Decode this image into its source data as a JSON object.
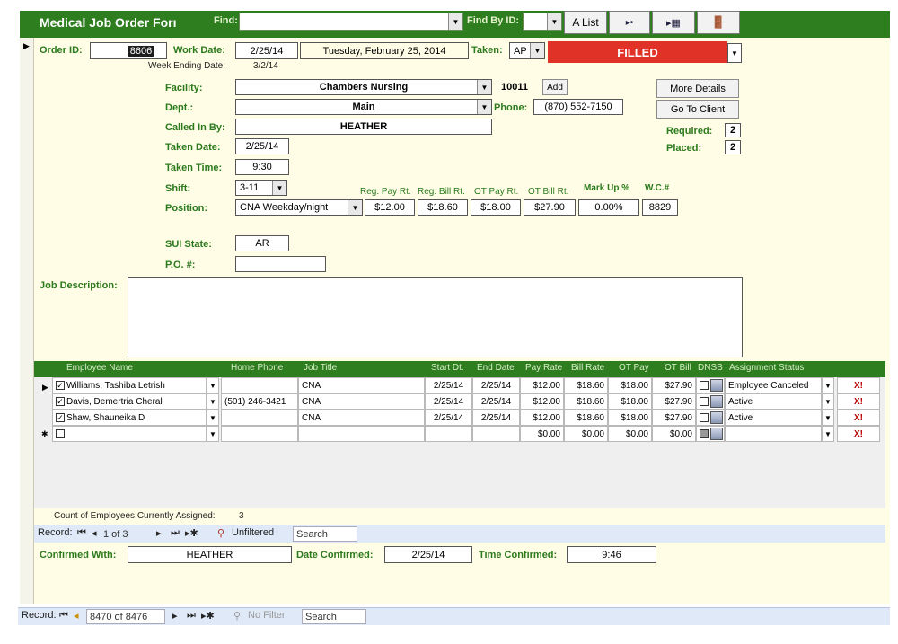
{
  "titlebar": {
    "title": "Medical Job Order Forı",
    "find_label": "Find:",
    "find_value": "",
    "find_by_id_label": "Find By ID:",
    "find_by_id_value": "",
    "a_list_button": "A List",
    "next_icon": "next-record-icon",
    "new_record_icon": "new-record-icon",
    "exit_icon": "exit-door-icon"
  },
  "order": {
    "order_id_label": "Order ID:",
    "order_id": "8606",
    "work_date_label": "Work Date:",
    "work_date": "2/25/14",
    "work_date_long": "Tuesday, February 25, 2014",
    "taken_label": "Taken:",
    "taken_value": "AP",
    "status": "FILLED",
    "week_ending_label": "Week Ending Date:",
    "week_ending": "3/2/14",
    "facility_label": "Facility:",
    "facility": "Chambers Nursing",
    "facility_id": "10011",
    "add_button": "Add",
    "dept_label": "Dept.:",
    "dept": "Main",
    "phone_label": "Phone:",
    "phone": "(870) 552-7150",
    "called_in_by_label": "Called In By:",
    "called_in_by": "HEATHER",
    "more_details_button": "More Details",
    "go_to_client_button": "Go To Client",
    "required_label": "Required:",
    "required": "2",
    "placed_label": "Placed:",
    "placed": "2",
    "taken_date_label": "Taken Date:",
    "taken_date": "2/25/14",
    "taken_time_label": "Taken Time:",
    "taken_time": "9:30",
    "shift_label": "Shift:",
    "shift": "3-11",
    "position_label": "Position:",
    "position": "CNA Weekday/night",
    "reg_pay_label": "Reg. Pay Rt.",
    "reg_pay": "$12.00",
    "reg_bill_label": "Reg. Bill Rt.",
    "reg_bill": "$18.60",
    "ot_pay_label": "OT Pay Rt.",
    "ot_pay": "$18.00",
    "ot_bill_label": "OT Bill Rt.",
    "ot_bill": "$27.90",
    "markup_label": "Mark Up %",
    "markup": "0.00%",
    "wc_label": "W.C.#",
    "wc": "8829",
    "sui_label": "SUI State:",
    "sui": "AR",
    "po_label": "P.O. #:",
    "po": "",
    "job_desc_label": "Job Description:",
    "job_desc": ""
  },
  "subform": {
    "headers": [
      "Employee Name",
      "Home Phone",
      "Job Title",
      "Start Dt.",
      "End Date",
      "Pay Rate",
      "Bill Rate",
      "OT Pay",
      "OT Bill",
      "DNSB",
      "Assignment Status"
    ],
    "rows": [
      {
        "name": "Williams, Tashiba Letrish",
        "phone": "",
        "title": "CNA",
        "start": "2/25/14",
        "end": "2/25/14",
        "pay": "$12.00",
        "bill": "$18.60",
        "otpay": "$18.00",
        "otbill": "$27.90",
        "status": "Employee Canceled",
        "x": "X!"
      },
      {
        "name": "Davis, Demertria Cheral",
        "phone": "(501) 246-3421",
        "title": "CNA",
        "start": "2/25/14",
        "end": "2/25/14",
        "pay": "$12.00",
        "bill": "$18.60",
        "otpay": "$18.00",
        "otbill": "$27.90",
        "status": "Active",
        "x": "X!"
      },
      {
        "name": "Shaw, Shauneika D",
        "phone": "",
        "title": "CNA",
        "start": "2/25/14",
        "end": "2/25/14",
        "pay": "$12.00",
        "bill": "$18.60",
        "otpay": "$18.00",
        "otbill": "$27.90",
        "status": "Active",
        "x": "X!"
      }
    ],
    "new_row": {
      "pay": "$0.00",
      "bill": "$0.00",
      "otpay": "$0.00",
      "otbill": "$0.00",
      "x": "X!"
    },
    "count_label": "Count of Employees Currently Assigned:",
    "count": "3",
    "nav": {
      "record_label": "Record:",
      "position": "1 of 3",
      "filter": "Unfiltered",
      "search": "Search"
    }
  },
  "confirm": {
    "confirmed_with_label": "Confirmed With:",
    "confirmed_with": "HEATHER",
    "date_confirmed_label": "Date Confirmed:",
    "date_confirmed": "2/25/14",
    "time_confirmed_label": "Time Confirmed:",
    "time_confirmed": "9:46"
  },
  "main_nav": {
    "record_label": "Record:",
    "position": "8470 of 8476",
    "filter": "No Filter",
    "search": "Search"
  },
  "colors": {
    "title_green": "#2e7d1f",
    "label_green": "#2b7a1c",
    "form_bg": "#fffde6",
    "filled_red": "#e13228",
    "nav_blue": "#dfe9f7"
  }
}
